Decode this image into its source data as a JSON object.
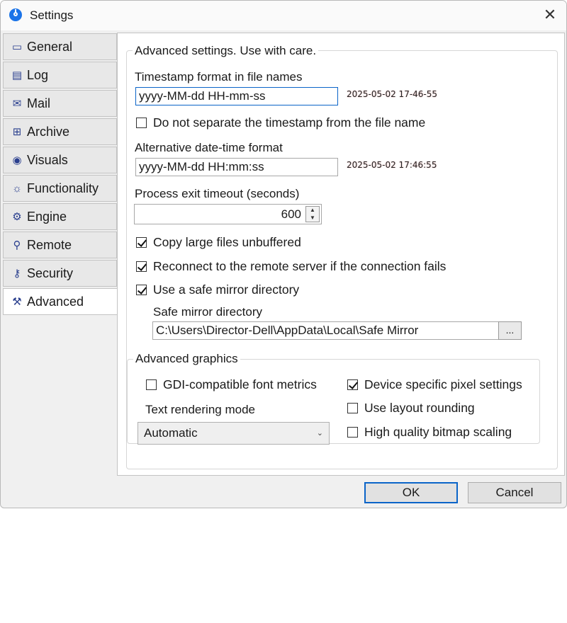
{
  "window": {
    "title": "Settings",
    "close_glyph": "✕"
  },
  "tabs": [
    {
      "label": "General",
      "icon": "monitor-icon",
      "glyph": "▭"
    },
    {
      "label": "Log",
      "icon": "document-icon",
      "glyph": "▤"
    },
    {
      "label": "Mail",
      "icon": "envelope-icon",
      "glyph": "✉"
    },
    {
      "label": "Archive",
      "icon": "archive-box-icon",
      "glyph": "⊞"
    },
    {
      "label": "Visuals",
      "icon": "eye-icon",
      "glyph": "◉"
    },
    {
      "label": "Functionality",
      "icon": "bulb-icon",
      "glyph": "☼"
    },
    {
      "label": "Engine",
      "icon": "gears-icon",
      "glyph": "⚙"
    },
    {
      "label": "Remote",
      "icon": "antenna-icon",
      "glyph": "⚲"
    },
    {
      "label": "Security",
      "icon": "key-icon",
      "glyph": "⚷"
    },
    {
      "label": "Advanced",
      "icon": "hammer-icon",
      "glyph": "⚒"
    }
  ],
  "active_tab": "Advanced",
  "advanced": {
    "group_title": "Advanced settings. Use with care.",
    "timestamp_label": "Timestamp format in file names",
    "timestamp_value": "yyyy-MM-dd HH-mm-ss",
    "timestamp_preview": "2025-05-02 17-46-55",
    "no_separate_label": "Do not separate the timestamp from the file name",
    "no_separate_checked": false,
    "alt_datetime_label": "Alternative date-time format",
    "alt_datetime_value": "yyyy-MM-dd HH:mm:ss",
    "alt_datetime_preview": "2025-05-02 17:46:55",
    "exit_timeout_label": "Process exit timeout (seconds)",
    "exit_timeout_value": "600",
    "copy_unbuffered_label": "Copy large files unbuffered",
    "copy_unbuffered_checked": true,
    "reconnect_label": "Reconnect to the remote server if the connection fails",
    "reconnect_checked": true,
    "safe_mirror_label": "Use a safe mirror directory",
    "safe_mirror_checked": true,
    "mirror_dir_label": "Safe mirror directory",
    "mirror_dir_value": "C:\\Users\\Director-Dell\\AppData\\Local\\Safe Mirror",
    "browse_label": "...",
    "graphics": {
      "title": "Advanced graphics",
      "gdi_label": "GDI-compatible font metrics",
      "gdi_checked": false,
      "text_mode_label": "Text rendering mode",
      "text_mode_value": "Automatic",
      "device_pixel_label": "Device specific pixel settings",
      "device_pixel_checked": true,
      "layout_rounding_label": "Use layout rounding",
      "layout_rounding_checked": false,
      "hq_bitmap_label": "High quality bitmap scaling",
      "hq_bitmap_checked": false
    }
  },
  "buttons": {
    "ok": "OK",
    "cancel": "Cancel"
  }
}
